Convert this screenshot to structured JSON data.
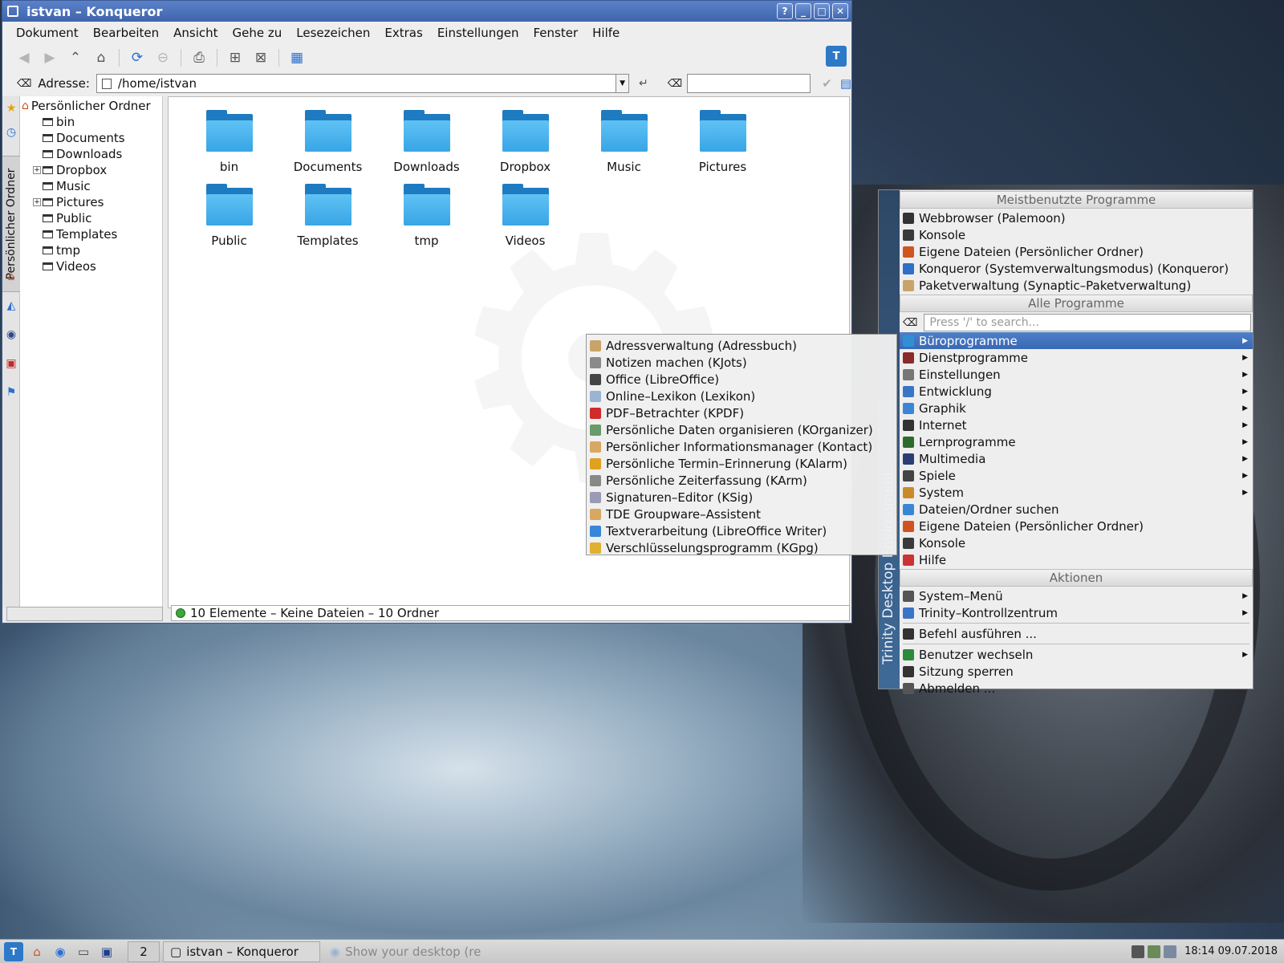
{
  "window": {
    "title": "istvan – Konqueror",
    "buttons": [
      "?",
      "_",
      "□",
      "✕"
    ]
  },
  "menubar": [
    "Dokument",
    "Bearbeiten",
    "Ansicht",
    "Gehe zu",
    "Lesezeichen",
    "Extras",
    "Einstellungen",
    "Fenster",
    "Hilfe"
  ],
  "address": {
    "label": "Adresse:",
    "value": "/home/istvan",
    "search_value": ""
  },
  "sidebar": {
    "tab_label": "Persönlicher Ordner",
    "root": "Persönlicher Ordner",
    "items": [
      {
        "label": "bin",
        "expandable": false
      },
      {
        "label": "Documents",
        "expandable": false
      },
      {
        "label": "Downloads",
        "expandable": false
      },
      {
        "label": "Dropbox",
        "expandable": true
      },
      {
        "label": "Music",
        "expandable": false
      },
      {
        "label": "Pictures",
        "expandable": true
      },
      {
        "label": "Public",
        "expandable": false
      },
      {
        "label": "Templates",
        "expandable": false
      },
      {
        "label": "tmp",
        "expandable": false
      },
      {
        "label": "Videos",
        "expandable": false
      }
    ]
  },
  "files": [
    "bin",
    "Documents",
    "Downloads",
    "Dropbox",
    "Music",
    "Pictures",
    "Public",
    "Templates",
    "tmp",
    "Videos"
  ],
  "status": "10 Elemente – Keine Dateien – 10 Ordner",
  "kmenu": {
    "sidebar_text": "Trinity Desktop Environment",
    "headers": {
      "most_used": "Meistbenutzte Programme",
      "all": "Alle Programme",
      "actions": "Aktionen"
    },
    "search_placeholder": "Press '/' to search...",
    "most_used": [
      {
        "label": "Webbrowser (Palemoon)",
        "color": "#333333"
      },
      {
        "label": "Konsole",
        "color": "#3a3a3a"
      },
      {
        "label": "Eigene Dateien (Persönlicher Ordner)",
        "color": "#d0541f"
      },
      {
        "label": "Konqueror (Systemverwaltungsmodus) (Konqueror)",
        "color": "#2f6fc9"
      },
      {
        "label": "Paketverwaltung (Synaptic–Paketverwaltung)",
        "color": "#c8a46a"
      }
    ],
    "categories": [
      {
        "label": "Büroprogramme",
        "submenu": true,
        "highlight": true,
        "color": "#2f8fd6"
      },
      {
        "label": "Dienstprogramme",
        "submenu": true,
        "color": "#8a2a2a"
      },
      {
        "label": "Einstellungen",
        "submenu": true,
        "color": "#777777"
      },
      {
        "label": "Entwicklung",
        "submenu": true,
        "color": "#3a74c7"
      },
      {
        "label": "Graphik",
        "submenu": true,
        "color": "#3a86d6"
      },
      {
        "label": "Internet",
        "submenu": true,
        "color": "#333333"
      },
      {
        "label": "Lernprogramme",
        "submenu": true,
        "color": "#2d6b2d"
      },
      {
        "label": "Multimedia",
        "submenu": true,
        "color": "#2b3e73"
      },
      {
        "label": "Spiele",
        "submenu": true,
        "color": "#444444"
      },
      {
        "label": "System",
        "submenu": true,
        "color": "#c98a2a"
      },
      {
        "label": "Dateien/Ordner suchen",
        "submenu": false,
        "color": "#3a86d6"
      },
      {
        "label": "Eigene Dateien (Persönlicher Ordner)",
        "submenu": false,
        "color": "#d0541f"
      },
      {
        "label": "Konsole",
        "submenu": false,
        "color": "#3a3a3a"
      },
      {
        "label": "Hilfe",
        "submenu": false,
        "color": "#cc3333"
      }
    ],
    "actions": [
      {
        "label": "System–Menü",
        "submenu": true,
        "color": "#555555"
      },
      {
        "label": "Trinity–Kontrollzentrum",
        "submenu": true,
        "color": "#3a74c7"
      },
      {
        "label": "Befehl ausführen ...",
        "submenu": false,
        "color": "#333333"
      },
      {
        "label": "Benutzer wechseln",
        "submenu": true,
        "color": "#2d8a3a"
      },
      {
        "label": "Sitzung sperren",
        "submenu": false,
        "color": "#333333"
      },
      {
        "label": "Abmelden ...",
        "submenu": false,
        "color": "#555555"
      }
    ]
  },
  "submenu": [
    {
      "label": "Adressverwaltung (Adressbuch)",
      "color": "#c8a46a"
    },
    {
      "label": "Notizen machen (KJots)",
      "color": "#8a8a8a"
    },
    {
      "label": "Office (LibreOffice)",
      "color": "#444444"
    },
    {
      "label": "Online–Lexikon (Lexikon)",
      "color": "#9ab4d4"
    },
    {
      "label": "PDF–Betrachter (KPDF)",
      "color": "#d02a2a"
    },
    {
      "label": "Persönliche Daten organisieren (KOrganizer)",
      "color": "#6a9a6a"
    },
    {
      "label": "Persönlicher Informationsmanager (Kontact)",
      "color": "#d8a860"
    },
    {
      "label": "Persönliche Termin–Erinnerung (KAlarm)",
      "color": "#e0a020"
    },
    {
      "label": "Persönliche Zeiterfassung (KArm)",
      "color": "#888888"
    },
    {
      "label": "Signaturen–Editor (KSig)",
      "color": "#9a9ab4"
    },
    {
      "label": "TDE Groupware–Assistent",
      "color": "#d8a860"
    },
    {
      "label": "Textverarbeitung (LibreOffice Writer)",
      "color": "#3a86d6"
    },
    {
      "label": "Verschlüsselungsprogramm (KGpg)",
      "color": "#e0b030"
    }
  ],
  "taskbar": {
    "desktop_number": "2",
    "tasks": [
      {
        "label": "istvan – Konqueror",
        "active": true
      },
      {
        "label": "Show your desktop (reb",
        "active": false
      }
    ],
    "clock": "18:14",
    "date": "09.07.2018"
  }
}
